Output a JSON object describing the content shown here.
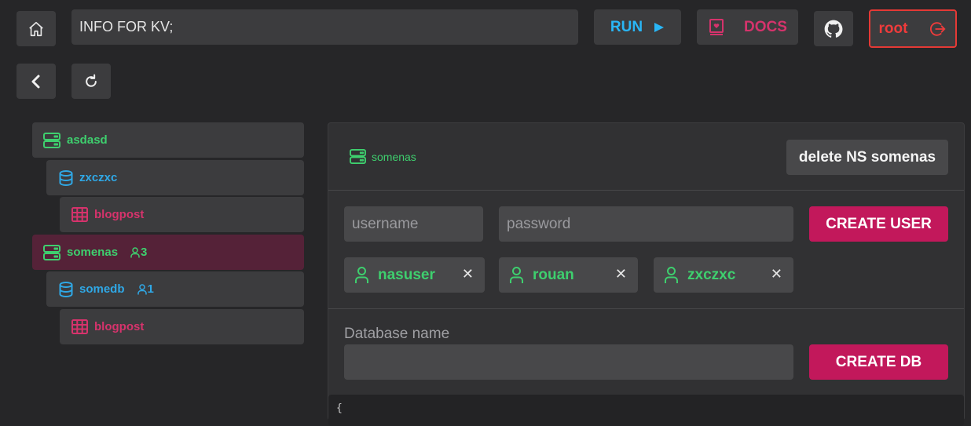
{
  "header": {
    "query_value": "INFO FOR KV;",
    "run_label": "RUN",
    "docs_label": "DOCS",
    "user_label": "root",
    "icons": {
      "home": "home-icon",
      "run": "play-icon",
      "docs": "book-heart-icon",
      "github": "github-icon",
      "logout": "logout-icon",
      "back": "chevron-left-icon",
      "refresh": "refresh-icon"
    }
  },
  "tree": {
    "items": [
      {
        "type": "namespace",
        "label": "asdasd",
        "selected": false
      },
      {
        "type": "database",
        "label": "zxczxc",
        "selected": false
      },
      {
        "type": "table",
        "label": "blogpost",
        "selected": false
      },
      {
        "type": "namespace",
        "label": "somenas",
        "user_count": "3",
        "selected": true
      },
      {
        "type": "database",
        "label": "somedb",
        "user_count": "1",
        "selected": false
      },
      {
        "type": "table",
        "label": "blogpost",
        "selected": false
      }
    ]
  },
  "panel": {
    "ns_name": "somenas",
    "delete_label": "delete NS somenas",
    "username_placeholder": "username",
    "password_placeholder": "password",
    "create_user_label": "CREATE USER",
    "users": [
      {
        "name": "nasuser",
        "remove": "✕"
      },
      {
        "name": "rouan",
        "remove": "✕"
      },
      {
        "name": "zxczxc",
        "remove": "✕"
      }
    ],
    "db_name_label": "Database name",
    "db_name_value": "",
    "create_db_label": "CREATE DB",
    "code_preview": "{"
  },
  "colors": {
    "namespace": "#3ecf6e",
    "database": "#2fa8e6",
    "table": "#d6336c",
    "accent": "#c2185b",
    "logout_border": "#e53935"
  }
}
